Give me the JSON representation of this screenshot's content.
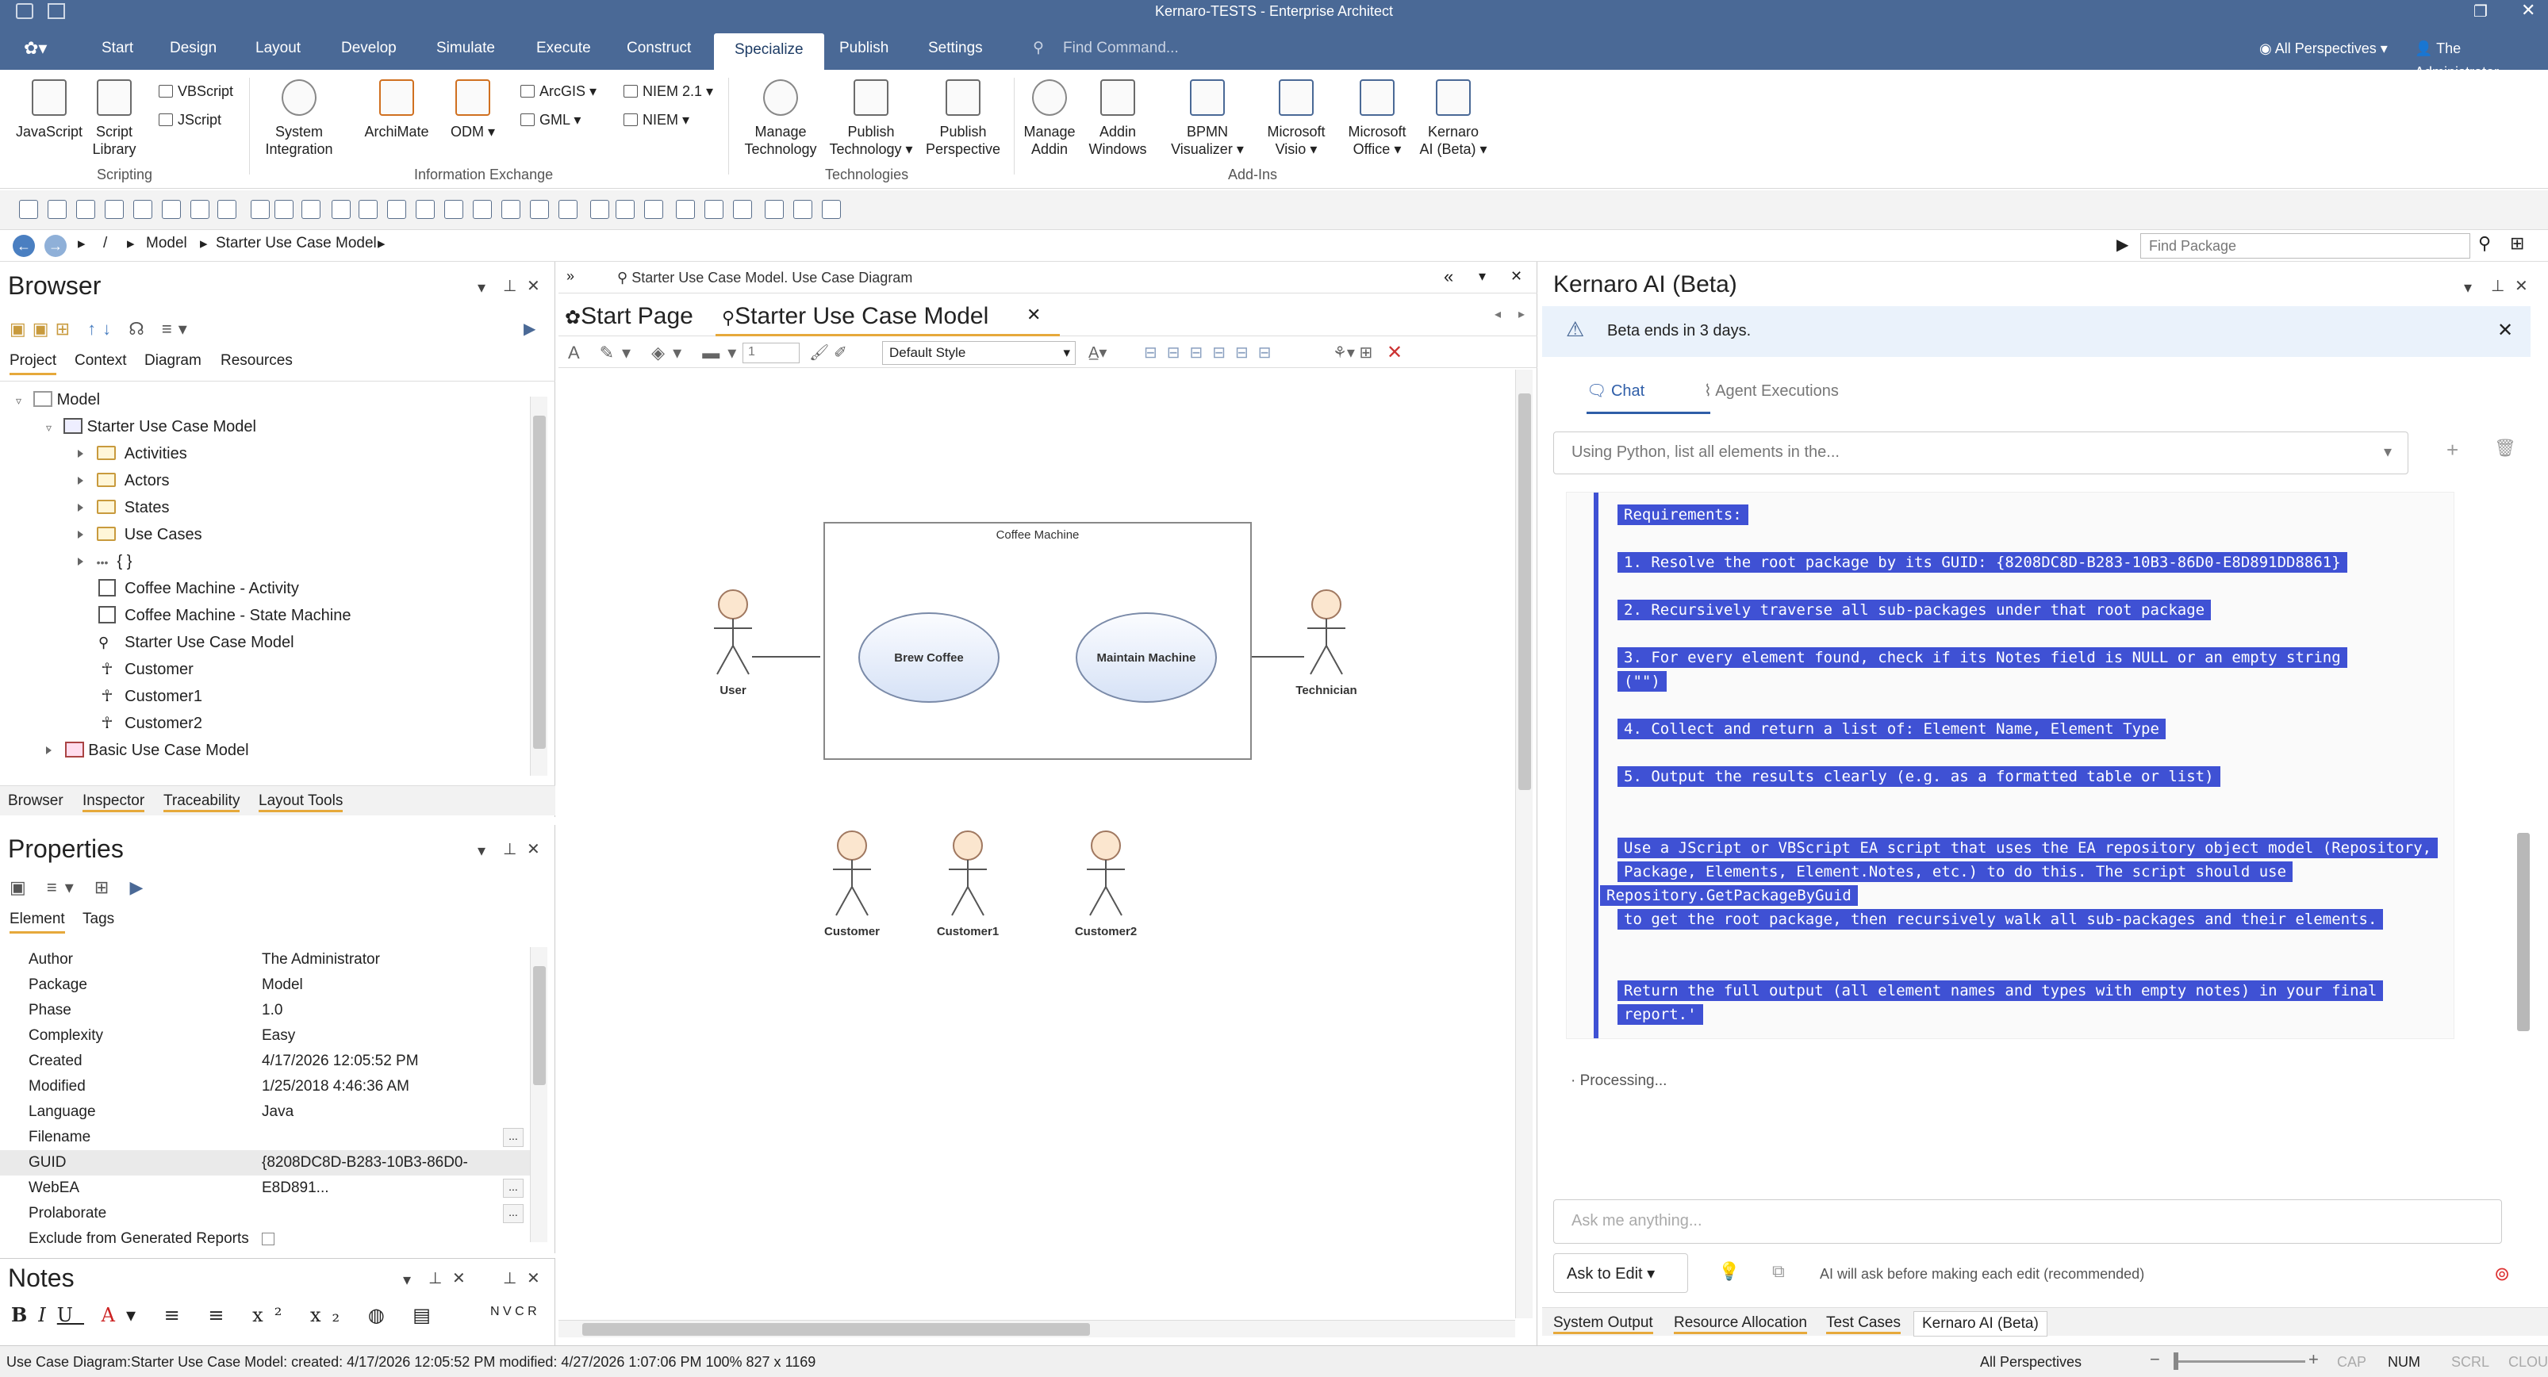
{
  "title": "Kernaro-TESTS - Enterprise Architect",
  "menu": [
    "Start",
    "Design",
    "Layout",
    "Develop",
    "Simulate",
    "Execute",
    "Construct",
    "Specialize",
    "Publish",
    "Settings"
  ],
  "menu_active": "Specialize",
  "find_command": "Find Command...",
  "perspectives": "All Perspectives",
  "user": "The Administrator",
  "ribbon": {
    "javascript": "JavaScript",
    "script_library": [
      "Script",
      "Library"
    ],
    "vbscript": "VBScript",
    "jscript": "JScript",
    "scripting": "Scripting",
    "system_integration": [
      "System",
      "Integration"
    ],
    "archimate": "ArchiMate",
    "odm": "ODM",
    "arcgis": "ArcGIS",
    "gml": "GML",
    "niem21": "NIEM 2.1",
    "niem": "NIEM",
    "info_exchange": "Information Exchange",
    "manage_tech": [
      "Manage",
      "Technology"
    ],
    "publish_tech": [
      "Publish",
      "Technology"
    ],
    "publish_persp": [
      "Publish",
      "Perspective"
    ],
    "technologies": "Technologies",
    "manage_addin": [
      "Manage",
      "Addin"
    ],
    "addin_windows": [
      "Addin",
      "Windows"
    ],
    "bpmn": [
      "BPMN",
      "Visualizer"
    ],
    "ms_visio": [
      "Microsoft",
      "Visio"
    ],
    "ms_office": [
      "Microsoft",
      "Office"
    ],
    "kernaro": [
      "Kernaro",
      "AI (Beta)"
    ],
    "addins": "Add-Ins"
  },
  "nav": {
    "sep": "/",
    "path1": "Model",
    "path2": "Starter Use Case Model",
    "find_package": "Find Package"
  },
  "browser": {
    "title": "Browser",
    "tabs": [
      "Project",
      "Context",
      "Diagram",
      "Resources"
    ],
    "tree": [
      "Model",
      "Starter Use Case Model",
      "Activities",
      "Actors",
      "States",
      "Use Cases",
      "{ }",
      "Coffee Machine - Activity",
      "Coffee Machine - State Machine",
      "Starter Use Case Model",
      "Customer",
      "Customer1",
      "Customer2",
      "Basic Use Case Model"
    ],
    "ellipsis": "•••",
    "bottom_tabs": [
      "Browser",
      "Inspector",
      "Traceability",
      "Layout Tools"
    ]
  },
  "properties": {
    "title": "Properties",
    "tabs": [
      "Element",
      "Tags"
    ],
    "rows": [
      [
        "Author",
        "The Administrator"
      ],
      [
        "Package",
        "Model"
      ],
      [
        "Phase",
        "1.0"
      ],
      [
        "Complexity",
        "Easy"
      ],
      [
        "Created",
        "4/17/2026 12:05:52 PM"
      ],
      [
        "Modified",
        "1/25/2018 4:46:36 AM"
      ],
      [
        "Language",
        "Java"
      ],
      [
        "Filename",
        ""
      ],
      [
        "GUID",
        "{8208DC8D-B283-10B3-86D0-E8D891..."
      ],
      [
        "WebEA",
        ""
      ],
      [
        "Prolaborate",
        ""
      ],
      [
        "Exclude from Generated Reports",
        ""
      ]
    ],
    "more": "..."
  },
  "notes": {
    "title": "Notes",
    "format": "N V C R"
  },
  "diagram": {
    "header": "Starter Use Case Model.  Use Case Diagram",
    "tab_start": "Start Page",
    "tab_model": "Starter Use Case Model",
    "style": "Default Style",
    "zoom_box": "1",
    "boundary": "Coffee Machine",
    "uc1": "Brew Coffee",
    "uc2": "Maintain Machine",
    "actors": [
      "User",
      "Technician",
      "Customer",
      "Customer1",
      "Customer2"
    ]
  },
  "ai": {
    "title": "Kernaro AI (Beta)",
    "beta": "Beta ends in 3 days.",
    "tab_chat": "Chat",
    "tab_agent": "Agent Executions",
    "conversation": "Using Python, list all elements in the...",
    "lines": [
      "Requirements:",
      "1. Resolve the root package by its GUID: {8208DC8D-B283-10B3-86D0-E8D891DD8861}",
      "2. Recursively traverse all sub-packages under that root package",
      "3. For every element found, check if its Notes field is NULL or an empty string",
      "(\"\")",
      "4. Collect and return a list of: Element Name, Element Type",
      "5. Output the results clearly (e.g. as a formatted table or list)",
      "Use a JScript or VBScript EA script that uses the EA repository object model (Repository,",
      "Package, Elements, Element.Notes, etc.) to do this. The script should use",
      "Repository.GetPackageByGuid",
      "to get the root package, then recursively walk all sub-packages and their elements.",
      "Return the full output (all element names and types with empty notes) in your final",
      "report.'"
    ],
    "processing": "Processing...",
    "ask_placeholder": "Ask me anything...",
    "mode": "Ask to Edit",
    "mode_hint": "AI will ask before making each edit (recommended)",
    "bottom_tabs": [
      "System Output",
      "Resource Allocation",
      "Test Cases",
      "Kernaro AI (Beta)"
    ]
  },
  "status": {
    "left": "Use Case Diagram:Starter Use Case Model:  created: 4/17/2026 12:05:52 PM  modified: 4/27/2026 1:07:06 PM  100%  827 x 1169",
    "persp": "All Perspectives",
    "cap": "CAP",
    "num": "NUM",
    "scrl": "SCRL",
    "clou": "CLOU"
  }
}
